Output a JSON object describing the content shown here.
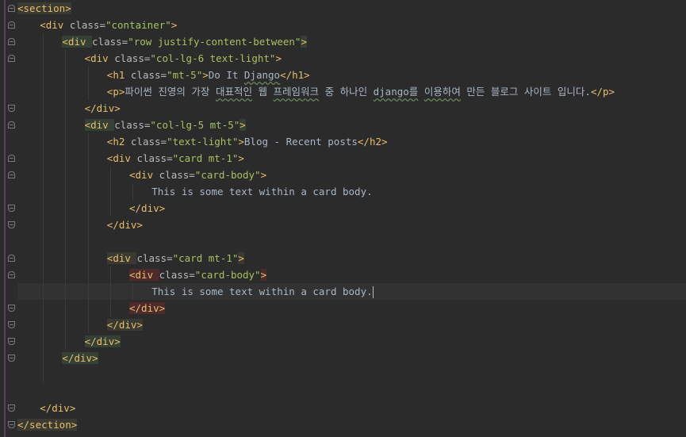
{
  "editor": {
    "lines": [
      {
        "indent": 0,
        "tokens": [
          [
            "tag",
            "<section>"
          ]
        ],
        "hl": "yellow"
      },
      {
        "indent": 1,
        "tokens": [
          [
            "tag",
            "<div "
          ],
          [
            "attr",
            "class="
          ],
          [
            "val",
            "\"container\""
          ],
          [
            "tag",
            ">"
          ]
        ]
      },
      {
        "indent": 2,
        "tokens": [
          [
            "tag",
            "<div "
          ],
          [
            "attr",
            "class="
          ],
          [
            "val",
            "\"row justify-content-between\""
          ],
          [
            "tag",
            ">"
          ]
        ],
        "hl": "green"
      },
      {
        "indent": 3,
        "tokens": [
          [
            "tag",
            "<div "
          ],
          [
            "attr",
            "class="
          ],
          [
            "val",
            "\"col-lg-6 text-light\""
          ],
          [
            "tag",
            ">"
          ]
        ]
      },
      {
        "indent": 4,
        "tokens": [
          [
            "tag",
            "<h1 "
          ],
          [
            "attr",
            "class="
          ],
          [
            "val",
            "\"mt-5\""
          ],
          [
            "tag",
            ">"
          ],
          [
            "txt",
            "Do It "
          ],
          [
            "sq",
            "Django"
          ],
          [
            "tag",
            "</h1>"
          ]
        ]
      },
      {
        "indent": 4,
        "tokens": [
          [
            "tag",
            "<p>"
          ],
          [
            "txt",
            "파이썬 진영의 가장 "
          ],
          [
            "sq",
            "대표적인"
          ],
          [
            "txt",
            " 웹 "
          ],
          [
            "sq",
            "프레임워크"
          ],
          [
            "txt",
            " 중 하나인 "
          ],
          [
            "sq",
            "django를"
          ],
          [
            "txt",
            " "
          ],
          [
            "sq",
            "이용하여"
          ],
          [
            "txt",
            " 만든 블로그 사이트 입니다."
          ],
          [
            "tag",
            "</p>"
          ]
        ]
      },
      {
        "indent": 3,
        "tokens": [
          [
            "tag",
            "</div>"
          ]
        ]
      },
      {
        "indent": 3,
        "tokens": [
          [
            "tag",
            "<div "
          ],
          [
            "attr",
            "class="
          ],
          [
            "val",
            "\"col-lg-5 mt-5\""
          ],
          [
            "tag",
            ">"
          ]
        ],
        "hl": "green"
      },
      {
        "indent": 4,
        "tokens": [
          [
            "tag",
            "<h2 "
          ],
          [
            "attr",
            "class="
          ],
          [
            "val",
            "\"text-light\""
          ],
          [
            "tag",
            ">"
          ],
          [
            "txt",
            "Blog - Recent posts"
          ],
          [
            "tag",
            "</h2>"
          ]
        ]
      },
      {
        "indent": 4,
        "tokens": [
          [
            "tag",
            "<div "
          ],
          [
            "attr",
            "class="
          ],
          [
            "val",
            "\"card mt-1\""
          ],
          [
            "tag",
            ">"
          ]
        ]
      },
      {
        "indent": 5,
        "tokens": [
          [
            "tag",
            "<div "
          ],
          [
            "attr",
            "class="
          ],
          [
            "val",
            "\"card-body\""
          ],
          [
            "tag",
            ">"
          ]
        ]
      },
      {
        "indent": 6,
        "tokens": [
          [
            "txt",
            "This is some text within a card body."
          ]
        ]
      },
      {
        "indent": 5,
        "tokens": [
          [
            "tag",
            "</div>"
          ]
        ]
      },
      {
        "indent": 4,
        "tokens": [
          [
            "tag",
            "</div>"
          ]
        ]
      },
      {
        "indent": 0,
        "tokens": []
      },
      {
        "indent": 4,
        "tokens": [
          [
            "tag",
            "<div "
          ],
          [
            "attr",
            "class="
          ],
          [
            "val",
            "\"card mt-1\""
          ],
          [
            "tag",
            ">"
          ]
        ],
        "hl": "yellow"
      },
      {
        "indent": 5,
        "tokens": [
          [
            "tag",
            "<div "
          ],
          [
            "attr",
            "class="
          ],
          [
            "val",
            "\"card-body\""
          ],
          [
            "tag",
            ">"
          ]
        ],
        "hl": "red"
      },
      {
        "indent": 6,
        "tokens": [
          [
            "txt",
            "This is some text within a card body."
          ]
        ],
        "current": true,
        "caret": true
      },
      {
        "indent": 5,
        "tokens": [
          [
            "tag",
            "</div>"
          ]
        ],
        "hl": "red"
      },
      {
        "indent": 4,
        "tokens": [
          [
            "tag",
            "</div>"
          ]
        ],
        "hl": "yellow"
      },
      {
        "indent": 3,
        "tokens": [
          [
            "tag",
            "</div>"
          ]
        ],
        "hl": "green"
      },
      {
        "indent": 2,
        "tokens": [
          [
            "tag",
            "</div>"
          ]
        ],
        "hl": "green"
      },
      {
        "indent": 0,
        "tokens": []
      },
      {
        "indent": 0,
        "tokens": []
      },
      {
        "indent": 1,
        "tokens": [
          [
            "tag",
            "</div>"
          ]
        ]
      },
      {
        "indent": 0,
        "tokens": [
          [
            "tag",
            "</section>"
          ]
        ],
        "hl": "yellow"
      }
    ]
  },
  "colors": {
    "background": "#2b2b2b",
    "tag": "#e8bf6a",
    "attribute": "#bababa",
    "value": "#a5c261",
    "text": "#a9b7c6"
  }
}
